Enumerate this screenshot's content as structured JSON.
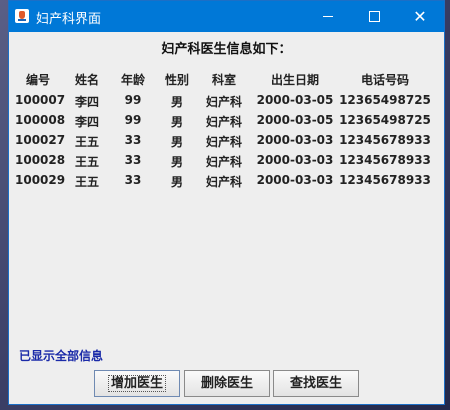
{
  "window": {
    "title": "妇产科界面"
  },
  "titlebar_controls": {
    "minimize": "—",
    "maximize": "□",
    "close": "✕"
  },
  "heading": "妇产科医生信息如下：",
  "table": {
    "headers": [
      "编号",
      "姓名",
      "年龄",
      "性别",
      "科室",
      "出生日期",
      "电话号码"
    ],
    "rows": [
      [
        "100007",
        "李四",
        "99",
        "男",
        "妇产科",
        "2000-03-05",
        "12365498725"
      ],
      [
        "100008",
        "李四",
        "99",
        "男",
        "妇产科",
        "2000-03-05",
        "12365498725"
      ],
      [
        "100027",
        "王五",
        "33",
        "男",
        "妇产科",
        "2000-03-03",
        "12345678933"
      ],
      [
        "100028",
        "王五",
        "33",
        "男",
        "妇产科",
        "2000-03-03",
        "12345678933"
      ],
      [
        "100029",
        "王五",
        "33",
        "男",
        "妇产科",
        "2000-03-03",
        "12345678933"
      ]
    ]
  },
  "status": "已显示全部信息",
  "buttons": {
    "add": "增加医生",
    "delete": "删除医生",
    "find": "查找医生"
  },
  "colors": {
    "titlebar": "#0078d7",
    "status_text": "#1a2aa8"
  }
}
